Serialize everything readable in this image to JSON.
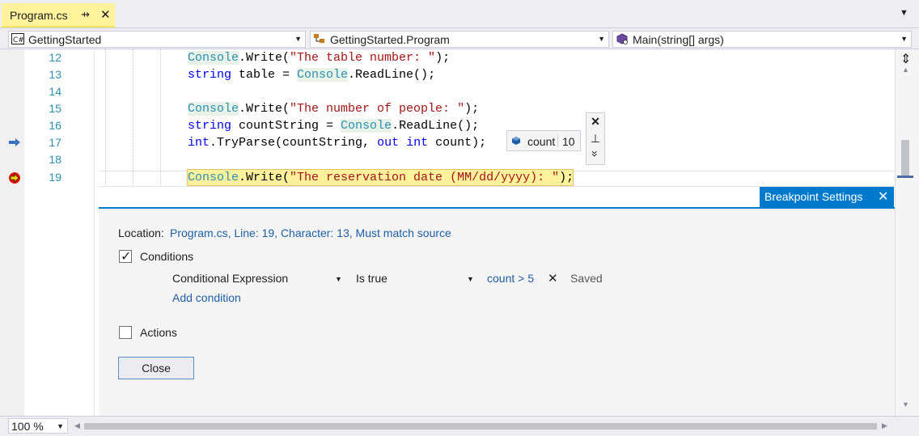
{
  "tab": {
    "title": "Program.cs",
    "pin_glyph": "⇸",
    "close_glyph": "✕",
    "overflow_glyph": "▼"
  },
  "navbar": {
    "project": "GettingStarted",
    "class": "GettingStarted.Program",
    "member": "Main(string[] args)"
  },
  "editor": {
    "line_numbers": [
      "12",
      "13",
      "14",
      "15",
      "16",
      "17",
      "18",
      "19"
    ],
    "lines": {
      "l12": {
        "cls": "Console",
        "rest": ".Write(",
        "str": "\"The table number: \"",
        "end": ");"
      },
      "l13": {
        "kw": "string",
        "mid": " table = ",
        "cls": "Console",
        "end": ".ReadLine();"
      },
      "l15": {
        "cls": "Console",
        "rest": ".Write(",
        "str": "\"The number of people: \"",
        "end": ");"
      },
      "l16": {
        "kw": "string",
        "mid": " countString = ",
        "cls": "Console",
        "end": ".ReadLine();"
      },
      "l17": {
        "kw": "int",
        "mid": ".TryParse(countString, ",
        "kw2": "out",
        "sp": " ",
        "kw3": "int",
        "end": " count);"
      },
      "l19": {
        "cls": "Console",
        "rest": ".Write(",
        "str": "\"The reservation date (MM/dd/yyyy): \"",
        "end": ");"
      }
    }
  },
  "datatip": {
    "name": "count",
    "value": "10",
    "close_glyph": "✕",
    "pin_glyph": "⊥",
    "expand_glyph": "»"
  },
  "breakpoint_settings": {
    "tab_label": "Breakpoint Settings",
    "close_glyph": "✕",
    "location_label": "Location:",
    "location_value": "Program.cs, Line: 19, Character: 13, Must match source",
    "conditions_label": "Conditions",
    "conditions_checked": true,
    "condition_type": "Conditional Expression",
    "condition_mode": "Is true",
    "condition_expression": "count > 5",
    "remove_glyph": "✕",
    "status": "Saved",
    "add_condition": "Add condition",
    "actions_label": "Actions",
    "actions_checked": false,
    "close_button": "Close"
  },
  "bottom": {
    "zoom": "100 %"
  },
  "colors": {
    "accent": "#007acc",
    "tab_active": "#fff29d",
    "current_line": "#fff29d",
    "breakpoint": "#e51400"
  }
}
